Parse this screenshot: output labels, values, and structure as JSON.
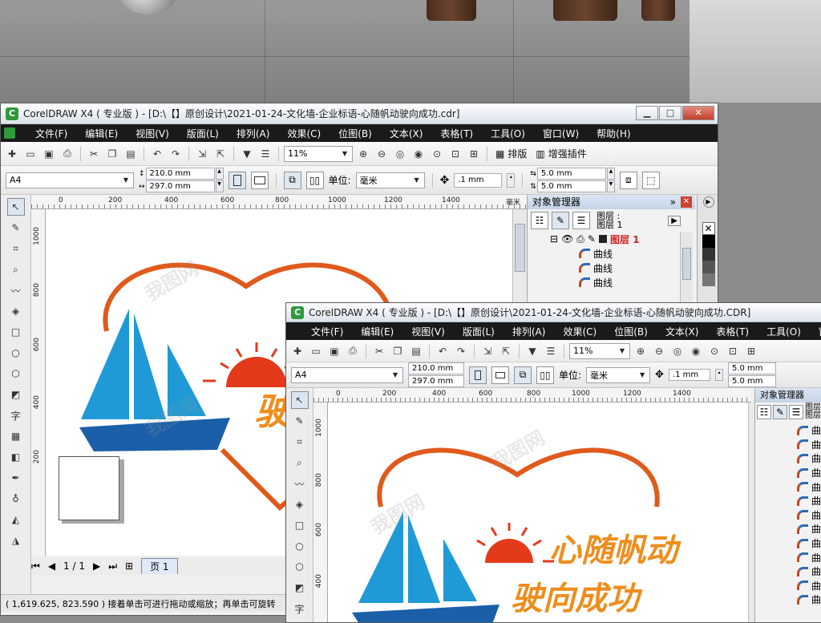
{
  "app": {
    "title": "CorelDRAW X4 ( 专业版 ) - [D:\\【】原创设计\\2021-01-24-文化墙-企业标语-心随帆动驶向成功.cdr]",
    "front_title": "CorelDRAW X4 ( 专业版 ) - [D:\\【】原创设计\\2021-01-24-文化墙-企业标语-心随帆动驶向成功.CDR]"
  },
  "menu": [
    "文件(F)",
    "编辑(E)",
    "视图(V)",
    "版面(L)",
    "排列(A)",
    "效果(C)",
    "位图(B)",
    "文本(X)",
    "表格(T)",
    "工具(O)",
    "窗口(W)",
    "帮助(H)"
  ],
  "toolbar": {
    "zoom": "11%",
    "layout_label": "排版",
    "plugin_label": "增强插件"
  },
  "propbar": {
    "paper": "A4",
    "width": "210.0 mm",
    "height": "297.0 mm",
    "unit_label": "单位:",
    "unit": "毫米",
    "nudge": ".1 mm",
    "dup_x": "5.0 mm",
    "dup_y": "5.0 mm"
  },
  "ruler": {
    "h_labels": [
      "0",
      "200",
      "400",
      "600",
      "800",
      "1000",
      "1200",
      "1400"
    ],
    "unit": "毫米",
    "v_labels": [
      "1000",
      "800",
      "600",
      "400",
      "200"
    ],
    "front_h_labels": [
      "0",
      "200",
      "400",
      "600",
      "800",
      "1000",
      "1200",
      "1400"
    ],
    "front_v_labels": [
      "1000",
      "800",
      "600",
      "400"
    ]
  },
  "object_manager": {
    "title": "对象管理器",
    "layer_info": "图层 :",
    "layer_current": "图层 1",
    "layer_name": "图层 1",
    "curve": "曲线",
    "front_layer_info": "图层",
    "front_layer_current": "图层"
  },
  "artwork": {
    "line1": "心随帆动",
    "line2": "驶向成功",
    "back_partial": "驶"
  },
  "pager": {
    "page_count": "1 / 1",
    "page_tab": "页 1"
  },
  "status": "( 1,619.625, 823.590 )  接着单击可进行拖动或缩放；再单击可旋转",
  "watermark": "我图网",
  "colors": {
    "heart": "#e05a1c",
    "sun": "#e33a1c",
    "sail": "#1f9ad6",
    "hull": "#1a5fa8",
    "slogan": "#ee8d1e"
  }
}
